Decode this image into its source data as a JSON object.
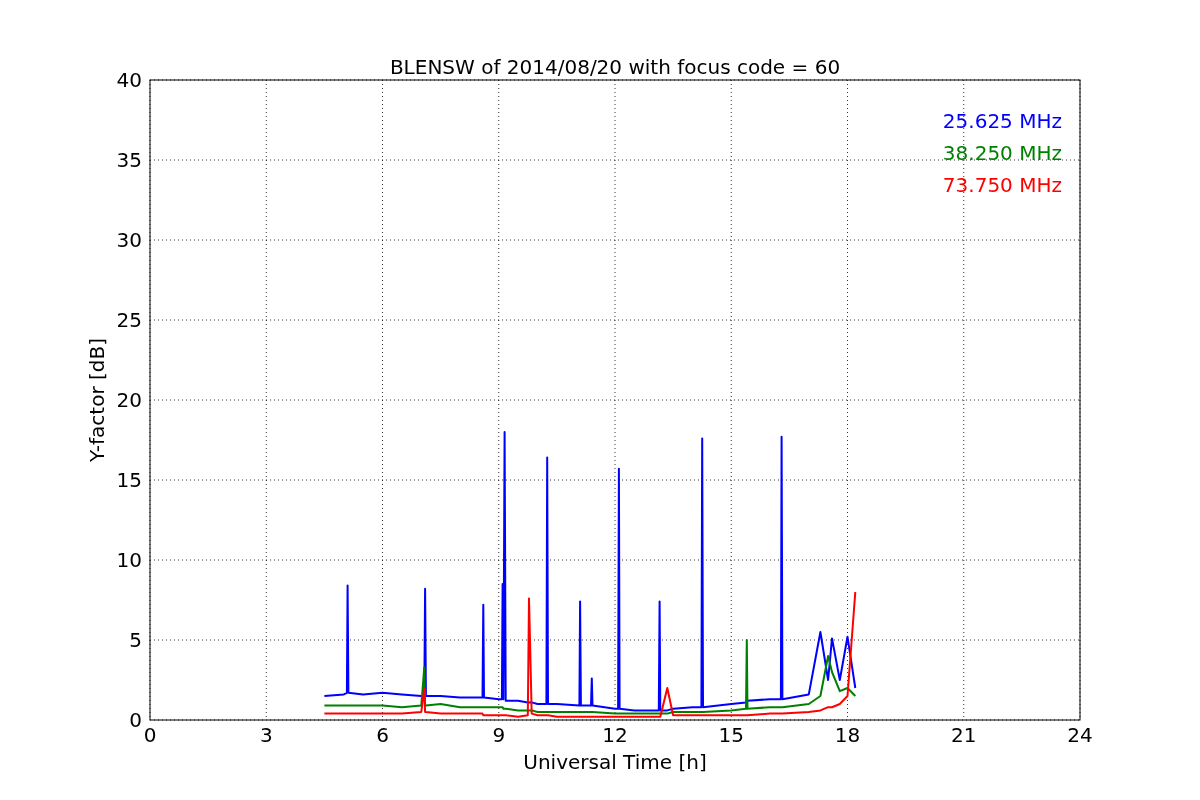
{
  "figure": {
    "chart_data": {
      "type": "line",
      "title": "BLENSW of 2014/08/20 with focus code = 60",
      "xlabel": "Universal Time [h]",
      "ylabel": "Y-factor [dB]",
      "x": [
        4.5,
        5.0,
        5.08,
        5.1,
        5.12,
        5.5,
        6.0,
        6.5,
        7.0,
        7.08,
        7.1,
        7.12,
        7.5,
        8.0,
        8.58,
        8.6,
        8.62,
        9.0,
        9.08,
        9.1,
        9.12,
        9.15,
        9.18,
        9.5,
        9.75,
        9.78,
        9.8,
        9.85,
        10.0,
        10.23,
        10.25,
        10.27,
        10.5,
        11.08,
        11.1,
        11.12,
        11.38,
        11.4,
        11.42,
        12.0,
        12.08,
        12.1,
        12.12,
        12.5,
        13.0,
        13.13,
        13.15,
        13.17,
        13.35,
        13.5,
        14.0,
        14.23,
        14.25,
        14.27,
        15.0,
        15.38,
        15.4,
        15.42,
        16.0,
        16.28,
        16.3,
        16.32,
        17.0,
        17.3,
        17.5,
        17.6,
        17.8,
        18.0,
        18.2
      ],
      "series": [
        {
          "name": "25.625 MHz",
          "color": "#0000ff",
          "values": [
            1.5,
            1.6,
            1.7,
            8.4,
            1.7,
            1.6,
            1.7,
            1.6,
            1.5,
            1.5,
            8.2,
            1.5,
            1.5,
            1.4,
            1.4,
            7.2,
            1.4,
            1.3,
            1.3,
            8.5,
            1.3,
            18.0,
            1.2,
            1.2,
            1.1,
            1.1,
            1.1,
            1.1,
            1.0,
            1.0,
            16.4,
            1.0,
            1.0,
            0.9,
            7.4,
            0.9,
            0.9,
            2.6,
            0.9,
            0.7,
            0.7,
            15.7,
            0.7,
            0.6,
            0.6,
            0.6,
            7.4,
            0.6,
            0.6,
            0.7,
            0.8,
            0.8,
            17.6,
            0.8,
            1.0,
            1.1,
            1.2,
            1.2,
            1.3,
            1.3,
            17.7,
            1.3,
            1.6,
            5.5,
            2.5,
            5.1,
            2.5,
            5.2,
            2.0
          ]
        },
        {
          "name": "38.250 MHz",
          "color": "#008000",
          "values": [
            0.9,
            0.9,
            0.9,
            0.9,
            0.9,
            0.9,
            0.9,
            0.8,
            0.9,
            3.3,
            0.9,
            0.9,
            1.0,
            0.8,
            0.8,
            0.8,
            0.8,
            0.8,
            0.8,
            0.8,
            0.7,
            0.7,
            0.7,
            0.6,
            0.6,
            0.6,
            0.6,
            0.6,
            0.5,
            0.5,
            0.5,
            0.5,
            0.5,
            0.5,
            0.5,
            0.5,
            0.5,
            0.5,
            0.5,
            0.4,
            0.4,
            0.4,
            0.4,
            0.4,
            0.4,
            0.4,
            0.4,
            0.4,
            0.4,
            0.5,
            0.5,
            0.5,
            0.5,
            0.5,
            0.6,
            0.7,
            5.0,
            0.7,
            0.8,
            0.8,
            0.8,
            0.8,
            1.0,
            1.5,
            4.0,
            3.0,
            1.8,
            2.0,
            1.5
          ]
        },
        {
          "name": "73.750 MHz",
          "color": "#ff0000",
          "values": [
            0.4,
            0.4,
            0.4,
            0.4,
            0.4,
            0.4,
            0.4,
            0.4,
            0.5,
            2.0,
            0.5,
            0.5,
            0.4,
            0.4,
            0.4,
            0.3,
            0.3,
            0.3,
            0.3,
            0.3,
            0.3,
            0.3,
            0.3,
            0.2,
            0.3,
            7.6,
            5.5,
            0.4,
            0.3,
            0.3,
            0.3,
            0.3,
            0.2,
            0.2,
            0.2,
            0.2,
            0.2,
            0.2,
            0.2,
            0.2,
            0.2,
            0.2,
            0.2,
            0.2,
            0.2,
            0.2,
            0.2,
            0.2,
            2.0,
            0.3,
            0.3,
            0.3,
            0.3,
            0.3,
            0.3,
            0.3,
            0.3,
            0.3,
            0.4,
            0.4,
            0.4,
            0.4,
            0.5,
            0.6,
            0.8,
            0.8,
            1.0,
            1.5,
            8.0
          ]
        }
      ],
      "grid": true,
      "xlim": [
        0,
        24
      ],
      "ylim": [
        0,
        40
      ],
      "xticks": [
        0,
        3,
        6,
        9,
        12,
        15,
        18,
        21,
        24
      ],
      "yticks": [
        0,
        5,
        10,
        15,
        20,
        25,
        30,
        35,
        40
      ]
    }
  }
}
